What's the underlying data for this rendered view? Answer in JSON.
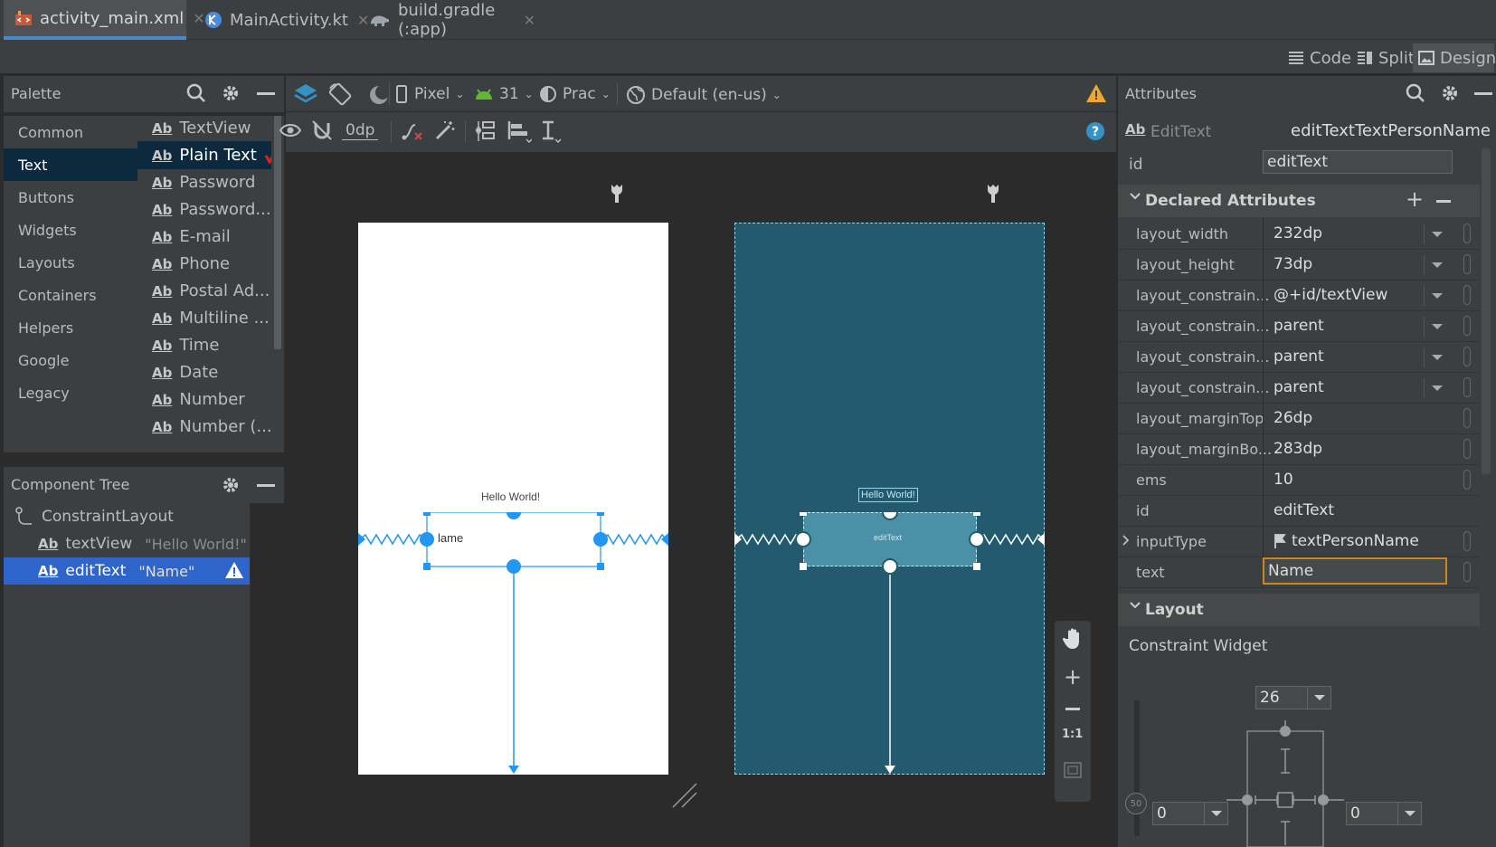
{
  "tabs": [
    {
      "label": "activity_main.xml",
      "icon": "layout-file-icon",
      "active": true
    },
    {
      "label": "MainActivity.kt",
      "icon": "kotlin-file-icon",
      "active": false
    },
    {
      "label": "build.gradle (:app)",
      "icon": "gradle-elephant-icon",
      "active": false
    }
  ],
  "view_modes": {
    "code": "Code",
    "split": "Split",
    "design": "Design"
  },
  "palette": {
    "title": "Palette",
    "categories": [
      "Common",
      "Text",
      "Buttons",
      "Widgets",
      "Layouts",
      "Containers",
      "Helpers",
      "Google",
      "Legacy"
    ],
    "selected_category": "Text",
    "items": [
      "TextView",
      "Plain Text",
      "Password",
      "Password...",
      "E-mail",
      "Phone",
      "Postal Ad...",
      "Multiline ...",
      "Time",
      "Date",
      "Number",
      "Number (..."
    ],
    "item_prefix": "Ab",
    "selected_item": "Plain Text"
  },
  "component_tree": {
    "title": "Component Tree",
    "root": "ConstraintLayout",
    "children": [
      {
        "prefix": "Ab",
        "name": "textView",
        "value": "\"Hello World!\"",
        "selected": false
      },
      {
        "prefix": "Ab",
        "name": "editText",
        "value": "\"Name\"",
        "selected": true,
        "warning": true
      }
    ]
  },
  "design_toolbar": {
    "device": "Pixel",
    "api": "31",
    "theme": "Prac",
    "locale": "Default (en-us)",
    "margin": "0dp"
  },
  "canvas": {
    "design_hello": "Hello World!",
    "design_edit": "lame",
    "blueprint_hello": "Hello World!",
    "blueprint_edit": "editText",
    "zoom_reset": "1:1"
  },
  "attributes": {
    "title": "Attributes",
    "widget_type": "EditText",
    "widget_id": "editTextTextPersonName",
    "id_label": "id",
    "id_value": "editText",
    "declared_title": "Declared Attributes",
    "rows": [
      {
        "name": "layout_width",
        "value": "232dp",
        "dropdown": true
      },
      {
        "name": "layout_height",
        "value": "73dp",
        "dropdown": true
      },
      {
        "name": "layout_constrain...",
        "value": "@+id/textView",
        "dropdown": true
      },
      {
        "name": "layout_constrain...",
        "value": "parent",
        "dropdown": true
      },
      {
        "name": "layout_constrain...",
        "value": "parent",
        "dropdown": true
      },
      {
        "name": "layout_constrain...",
        "value": "parent",
        "dropdown": true
      },
      {
        "name": "layout_marginTop",
        "value": "26dp",
        "dropdown": false
      },
      {
        "name": "layout_marginBo...",
        "value": "283dp",
        "dropdown": false
      },
      {
        "name": "ems",
        "value": "10",
        "dropdown": false
      },
      {
        "name": "id",
        "value": "editText",
        "dropdown": false
      },
      {
        "name": "inputType",
        "value": "textPersonName",
        "dropdown": false
      },
      {
        "name": "text",
        "value": "Name",
        "dropdown": false
      }
    ],
    "layout_title": "Layout",
    "constraint_widget_label": "Constraint Widget",
    "margin_top": "26",
    "margin_left": "0",
    "margin_right": "0",
    "bias": "50"
  },
  "colors": {
    "accent_blue": "#2196f3",
    "blueprint_bg": "#235a6e",
    "selection": "#2f65ca",
    "warning": "#f0a732",
    "highlight_border": "#c9871f"
  }
}
